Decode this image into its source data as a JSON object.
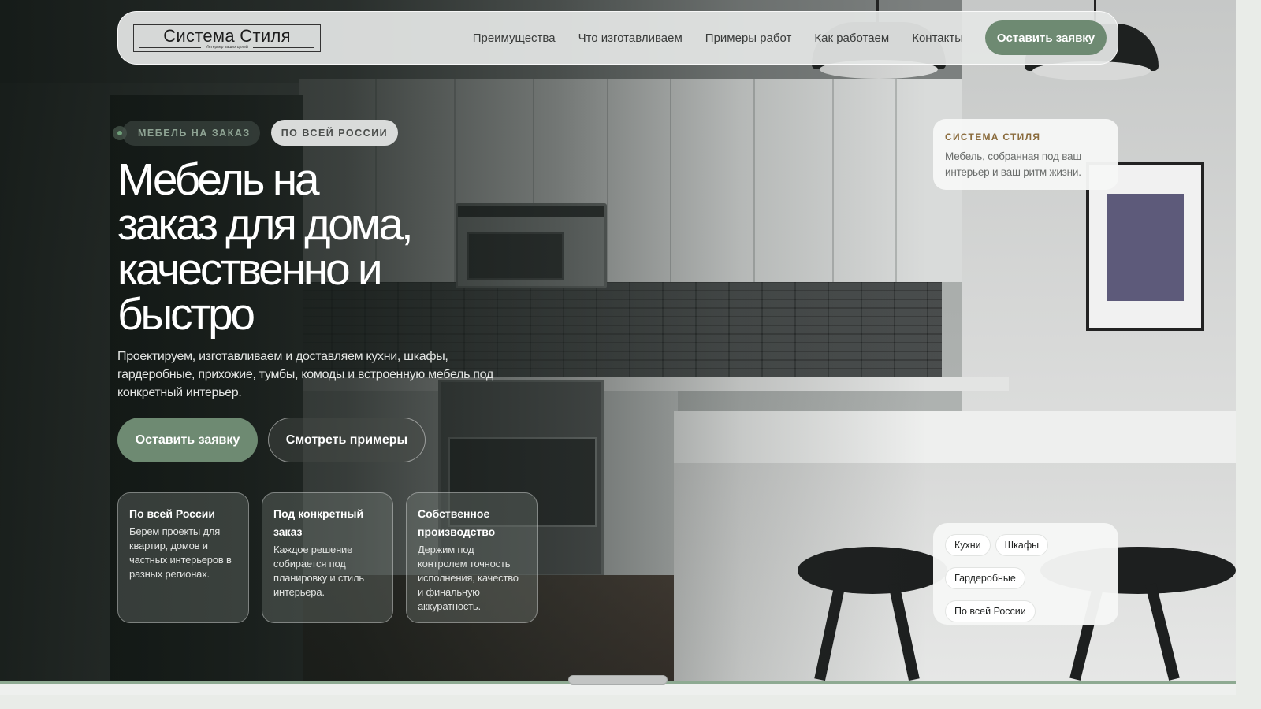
{
  "header": {
    "logo_title": "Система Стиля",
    "logo_subtitle": "Интерьер ваших целей",
    "nav": [
      "Преимущества",
      "Что изготавливаем",
      "Примеры работ",
      "Как работаем",
      "Контакты"
    ],
    "cta_label": "Оставить заявку"
  },
  "hero": {
    "tag_primary": "МЕБЕЛЬ НА ЗАКАЗ",
    "tag_secondary": "ПО ВСЕЙ РОССИИ",
    "title_lines": [
      "Мебель на",
      "заказ для дома,",
      "качественно и",
      "быстро"
    ],
    "description": "Проектируем, изготавливаем и доставляем кухни, шкафы, гардеробные, прихожие, тумбы, комоды и встроенную мебель под конкретный интерьер.",
    "btn_primary": "Оставить заявку",
    "btn_secondary": "Смотреть примеры"
  },
  "features": [
    {
      "title": "По всей России",
      "text": "Берем проекты для квартир, домов и частных интерьеров в разных регионах."
    },
    {
      "title": "Под конкретный заказ",
      "text": "Каждое решение собирается под планировку и стиль интерьера."
    },
    {
      "title": "Собственное производство",
      "text": "Держим под контролем точность исполнения, качество и финальную аккуратность."
    }
  ],
  "info_card": {
    "brand": "СИСТЕМА СТИЛЯ",
    "text": "Мебель, собранная под ваш интерьер и ваш ритм жизни."
  },
  "categories": [
    "Кухни",
    "Шкафы",
    "Гардеробные",
    "По всей России"
  ],
  "colors": {
    "accent": "#6e8a72",
    "brand_gold": "#8a6b3c"
  }
}
